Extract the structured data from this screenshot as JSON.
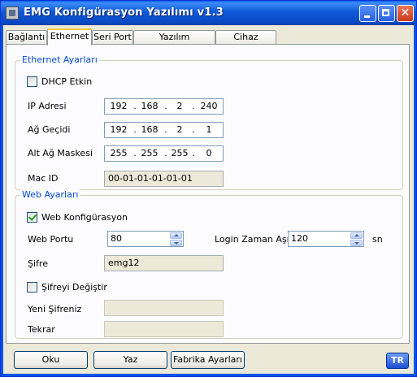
{
  "window": {
    "title": "EMG Konfigürasyon Yazılımı v1.3"
  },
  "tabs": [
    "Bağlantı",
    "Ethernet",
    "Seri Port",
    "Yazılım Güncelleme",
    "Cihaz Bilgileri"
  ],
  "active_tab": "Ethernet",
  "ethernet": {
    "group_title": "Ethernet Ayarları",
    "dhcp_label": "DHCP Etkin",
    "dhcp_checked": false,
    "ip_label": "IP Adresi",
    "ip": [
      "192",
      "168",
      "2",
      "240"
    ],
    "gateway_label": "Ağ Geçidi",
    "gateway": [
      "192",
      "168",
      "2",
      "1"
    ],
    "mask_label": "Alt Ağ Maskesi",
    "mask": [
      "255",
      "255",
      "255",
      "0"
    ],
    "mac_label": "Mac ID",
    "mac": "00-01-01-01-01-01"
  },
  "web": {
    "group_title": "Web Ayarları",
    "config_label": "Web Konfigürasyon",
    "config_checked": true,
    "port_label": "Web Portu",
    "port": "80",
    "timeout_label": "Login Zaman Aşımı",
    "timeout": "120",
    "timeout_unit": "sn",
    "password_label": "Şifre",
    "password": "emg12",
    "change_password_label": "Şifreyi Değiştir",
    "change_password_checked": false,
    "new_password_label": "Yeni Şifreniz",
    "new_password": "",
    "repeat_label": "Tekrar",
    "repeat": ""
  },
  "buttons": {
    "read": "Oku",
    "write": "Yaz",
    "factory": "Fabrika Ayarları",
    "lang": "TR"
  },
  "dot": "."
}
